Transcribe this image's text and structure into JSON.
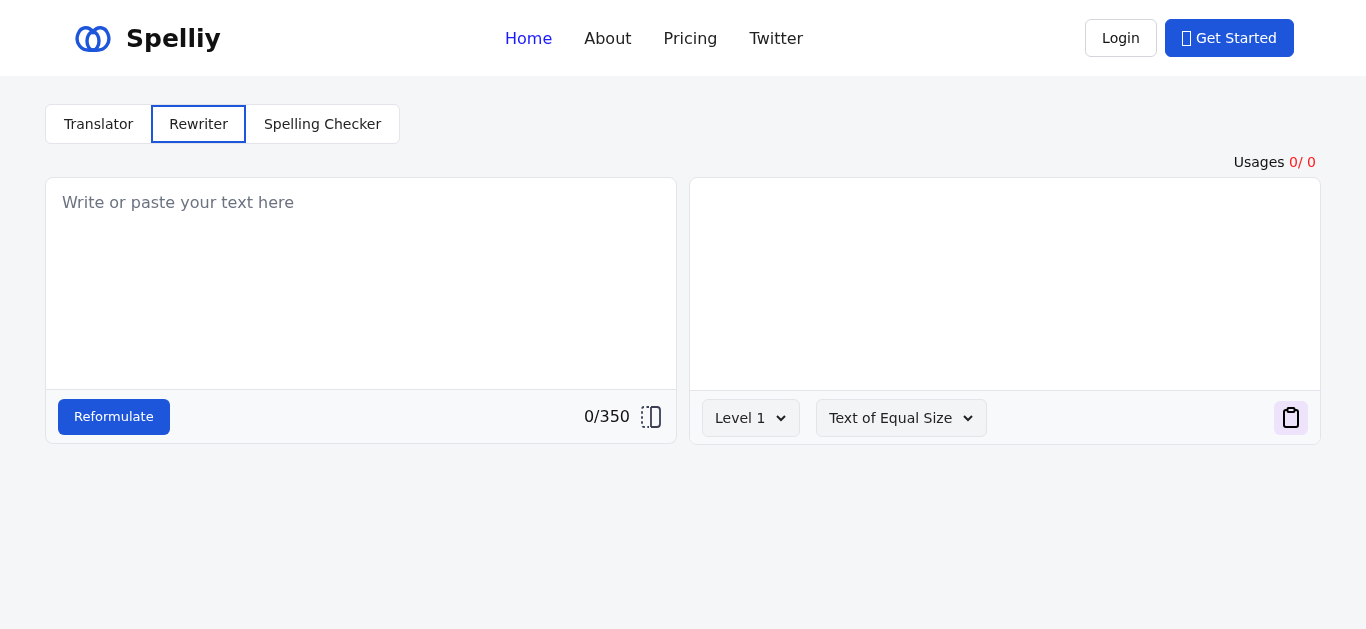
{
  "brand": {
    "name": "Spelliy"
  },
  "nav": [
    {
      "label": "Home",
      "selected": true
    },
    {
      "label": "About",
      "selected": false
    },
    {
      "label": "Pricing",
      "selected": false
    },
    {
      "label": "Twitter",
      "selected": false
    }
  ],
  "header_buttons": [
    {
      "label": "Login",
      "kind": "outline"
    },
    {
      "label": "Get Started",
      "kind": "primary"
    }
  ],
  "tabs": [
    {
      "label": "Translator",
      "selected": false
    },
    {
      "label": "Rewriter",
      "selected": true
    },
    {
      "label": "Spelling Checker",
      "selected": false
    }
  ],
  "usages": {
    "label": "Usages",
    "value": "0/ 0"
  },
  "input_panel": {
    "placeholder": "Write or paste your text here",
    "button": "Reformulate",
    "counter": "0/350"
  },
  "output_panel": {
    "selects": [
      {
        "value": "Level 1"
      },
      {
        "value": "Text of Equal Size"
      }
    ]
  }
}
